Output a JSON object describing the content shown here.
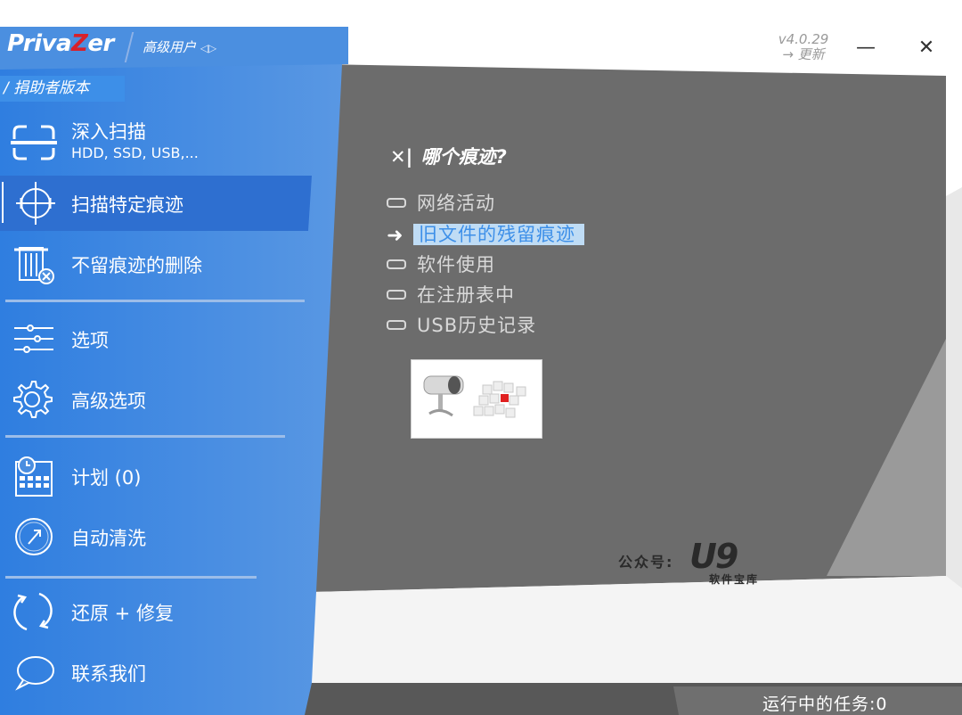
{
  "app": {
    "logo_prefix": "Priva",
    "logo_z": "Z",
    "logo_suffix": "er",
    "user_level": "高级用户",
    "user_level_arrows": "◁▷",
    "edition": "/ 捐助者版本",
    "version": "v4.0.29",
    "update": "→ 更新"
  },
  "window": {
    "minimize": "—",
    "close": "✕"
  },
  "sidebar": {
    "items": [
      {
        "label": "深入扫描",
        "sub": "HDD, SSD, USB,...",
        "icon": "deep-scan-icon"
      },
      {
        "label": "扫描特定痕迹",
        "icon": "crosshair-icon",
        "active": true
      },
      {
        "label": "不留痕迹的删除",
        "icon": "trash-delete-icon"
      },
      {
        "label": "选项",
        "icon": "sliders-icon"
      },
      {
        "label": "高级选项",
        "icon": "gear-icon"
      },
      {
        "label": "计划 (0)",
        "icon": "calendar-clock-icon"
      },
      {
        "label": "自动清洗",
        "icon": "auto-clean-icon"
      },
      {
        "label": "还原 + 修复",
        "icon": "restore-icon"
      },
      {
        "label": "联系我们",
        "icon": "chat-bubble-icon"
      }
    ]
  },
  "content": {
    "close_mark": "✕|",
    "title": "哪个痕迹?",
    "traces": [
      {
        "label": "网络活动",
        "selected": false
      },
      {
        "label": "旧文件的残留痕迹",
        "selected": true
      },
      {
        "label": "软件使用",
        "selected": false
      },
      {
        "label": "在注册表中",
        "selected": false
      },
      {
        "label": "USB历史记录",
        "selected": false
      }
    ],
    "selected_arrow": "➜"
  },
  "watermark": {
    "prefix": "公众号:",
    "logo": "U9",
    "sub": "软件宝库"
  },
  "status": {
    "running_tasks": "运行中的任务:0"
  }
}
